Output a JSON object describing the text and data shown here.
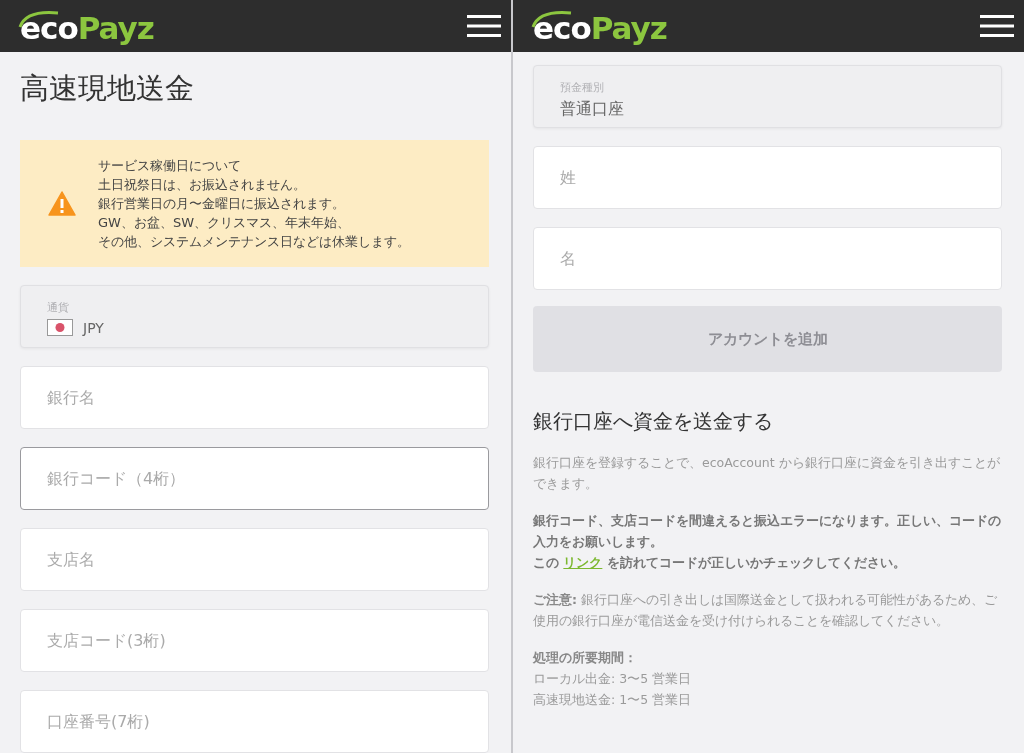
{
  "screens": [
    {
      "header": {
        "logo_light": "eco",
        "logo_accent": "Payz"
      },
      "title": "高速現地送金",
      "alert": {
        "lines": [
          "サービス稼働日について",
          "土日祝祭日は、お振込されません。",
          "銀行営業日の月〜金曜日に振込されます。",
          "GW、お盆、SW、クリスマス、年末年始、",
          "その他、システムメンテナンス日などは休業します。"
        ]
      },
      "fields": [
        {
          "kind": "currency",
          "label": "通貨",
          "value": "JPY"
        },
        {
          "kind": "text",
          "placeholder": "銀行名",
          "focused": false
        },
        {
          "kind": "text",
          "placeholder": "銀行コード（4桁）",
          "focused": true
        },
        {
          "kind": "text",
          "placeholder": "支店名",
          "focused": false
        },
        {
          "kind": "text",
          "placeholder": "支店コード(3桁)",
          "focused": false
        },
        {
          "kind": "text",
          "placeholder": "口座番号(7桁)",
          "focused": false
        }
      ]
    },
    {
      "header": {
        "logo_light": "eco",
        "logo_accent": "Payz"
      },
      "fields": [
        {
          "kind": "select",
          "label": "預金種別",
          "value": "普通口座"
        },
        {
          "kind": "text",
          "placeholder": "姓",
          "focused": false
        },
        {
          "kind": "text",
          "placeholder": "名",
          "focused": false
        }
      ],
      "button": {
        "label": "アカウントを追加",
        "disabled": true
      },
      "info": {
        "heading": "銀行口座へ資金を送金する",
        "intro": "銀行口座を登録することで、ecoAccount から銀行口座に資金を引き出すことができます。",
        "warning": {
          "text": "銀行コード、支店コードを間違えると振込エラーになります。正しい、コードの入力をお願いします。",
          "link_prefix": "この",
          "link": "リンク",
          "link_suffix": "を訪れてコードが正しいかチェックしてください。"
        },
        "note": "**ご注意:** 銀行口座への引き出しは国際送金として扱われる可能性があるため、ご使用の銀行口座が電信送金を受け付けられることを確認してください。",
        "timing_title": "処理の所要期間：",
        "timing_lines": [
          "ローカル出金: 3〜5 営業日",
          "高速現地送金: 1〜5 営業日"
        ]
      }
    }
  ]
}
